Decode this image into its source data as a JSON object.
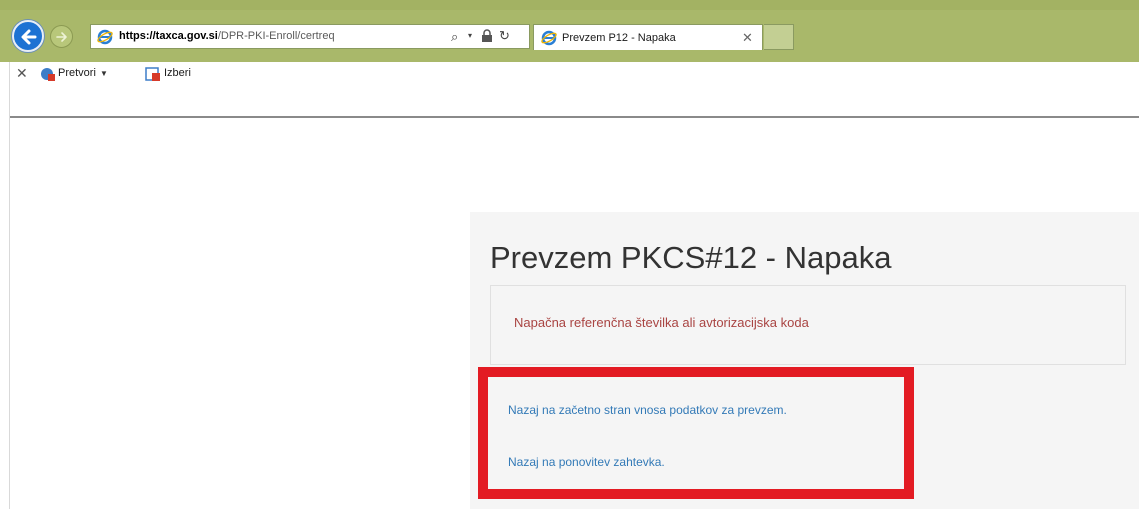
{
  "browser": {
    "url_host": "https://taxca.gov.si",
    "url_path": "/DPR-PKI-Enroll/certreq",
    "tab_title": "Prevzem P12 - Napaka",
    "toolbar": {
      "convert_label": "Pretvori",
      "select_label": "Izberi"
    }
  },
  "page": {
    "title": "Prevzem PKCS#12 - Napaka",
    "error_message": "Napačna referenčna številka ali avtorizacijska koda",
    "links": {
      "start": "Nazaj na začetno stran vnosa podatkov za prevzem.",
      "retry": "Nazaj na ponovitev zahtevka."
    }
  },
  "colors": {
    "chrome": "#a9b86a",
    "error_text": "#a94442",
    "link": "#337ab7",
    "highlight": "#e31b23",
    "back_button": "#1d72d3"
  },
  "icons": {
    "back": "back-arrow-icon",
    "forward": "forward-arrow-icon",
    "site": "internet-explorer-icon",
    "search": "search-icon",
    "lock": "lock-icon",
    "refresh": "refresh-icon",
    "close": "close-icon"
  }
}
